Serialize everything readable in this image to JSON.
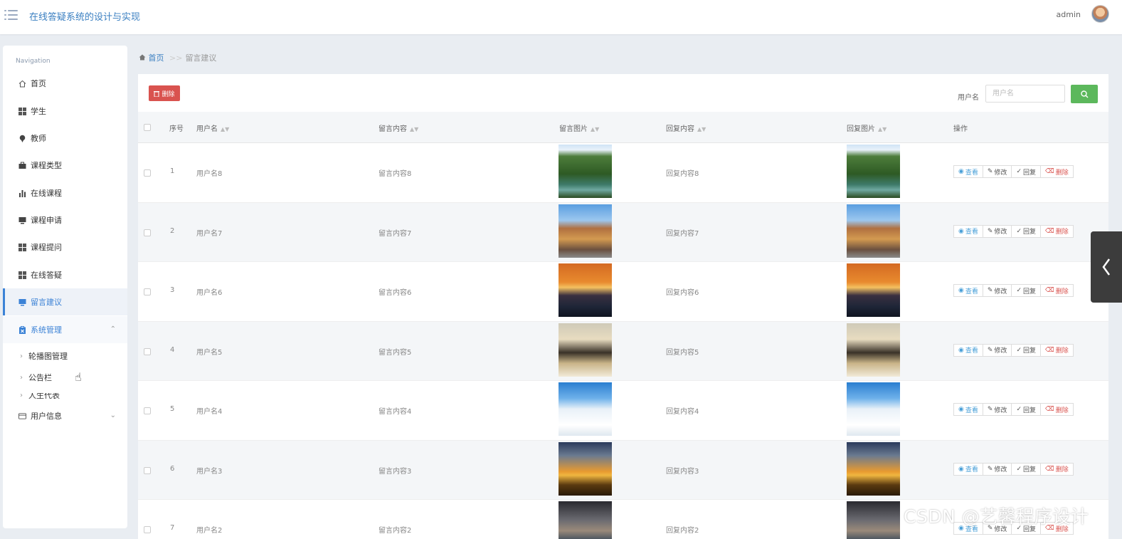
{
  "header": {
    "title": "在线答疑系统的设计与实现",
    "user": "admin"
  },
  "sidebar": {
    "heading": "Navigation",
    "items": [
      {
        "label": "首页",
        "icon": "home-icon"
      },
      {
        "label": "学生",
        "icon": "grid-icon"
      },
      {
        "label": "教师",
        "icon": "pin-icon"
      },
      {
        "label": "课程类型",
        "icon": "briefcase-icon"
      },
      {
        "label": "在线课程",
        "icon": "bar-chart-icon"
      },
      {
        "label": "课程申请",
        "icon": "monitor-icon"
      },
      {
        "label": "课程提问",
        "icon": "grid-icon"
      },
      {
        "label": "在线答疑",
        "icon": "grid-icon"
      },
      {
        "label": "留言建议",
        "icon": "monitor-icon"
      },
      {
        "label": "系统管理",
        "icon": "clipboard-icon"
      }
    ],
    "submenu": [
      "轮播图管理",
      "公告栏",
      "人生代表"
    ],
    "user_info": "用户信息"
  },
  "breadcrumb": {
    "home": "首页",
    "sep": ">>",
    "current": "留言建议"
  },
  "toolbar": {
    "delete_label": "删除",
    "search_label": "用户名",
    "search_placeholder": "用户名"
  },
  "table": {
    "headers": [
      "序号",
      "用户名",
      "留言内容",
      "留言图片",
      "回复内容",
      "回复图片",
      "操作"
    ],
    "rows": [
      {
        "no": "1",
        "user": "用户名8",
        "content": "留言内容8",
        "reply": "回复内容8",
        "img": "forest-river"
      },
      {
        "no": "2",
        "user": "用户名7",
        "content": "留言内容7",
        "reply": "回复内容7",
        "img": "old-town-tower"
      },
      {
        "no": "3",
        "user": "用户名6",
        "content": "留言内容6",
        "reply": "回复内容6",
        "img": "sunset-shore"
      },
      {
        "no": "4",
        "user": "用户名5",
        "content": "留言内容5",
        "reply": "回复内容5",
        "img": "people-lake"
      },
      {
        "no": "5",
        "user": "用户名4",
        "content": "留言内容4",
        "reply": "回复内容4",
        "img": "snowy-mountain"
      },
      {
        "no": "6",
        "user": "用户名3",
        "content": "留言内容3",
        "reply": "回复内容3",
        "img": "sunset-grass"
      },
      {
        "no": "7",
        "user": "用户名2",
        "content": "留言内容2",
        "reply": "回复内容2",
        "img": "dusk-tree"
      }
    ],
    "actions": {
      "view": "查看",
      "edit": "修改",
      "reply": "回复",
      "delete": "删除"
    }
  },
  "watermark": "CSDN @艺馨程序设计",
  "colors": {
    "primary": "#3b82d6",
    "danger": "#d9534f",
    "success": "#5cb85c"
  }
}
